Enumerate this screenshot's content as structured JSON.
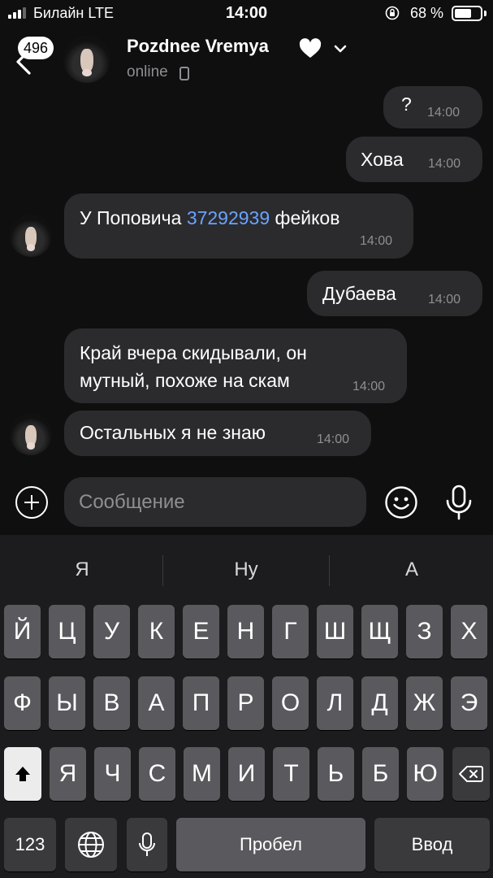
{
  "status_bar": {
    "carrier": "Билайн  LTE",
    "time": "14:00",
    "battery": "68 %",
    "battery_level": 0.68
  },
  "header": {
    "unread_count": "496",
    "contact_name": "Pozdnee Vremya",
    "status": "online"
  },
  "messages": [
    {
      "direction": "out",
      "text": "?",
      "time": "14:00"
    },
    {
      "direction": "out",
      "text": "Хова",
      "time": "14:00"
    },
    {
      "direction": "in",
      "text_before": "У Поповича ",
      "number": "37292939",
      "text_after": " фейков",
      "time": "14:00"
    },
    {
      "direction": "out",
      "text": "Дубаева",
      "time": "14:00"
    },
    {
      "direction": "in",
      "lines": [
        "Край вчера скидывали, он",
        "мутный, похоже на скам"
      ],
      "time": "14:00"
    },
    {
      "direction": "in",
      "text": "Остальных я не знаю",
      "time": "14:00"
    }
  ],
  "composer": {
    "placeholder": "Сообщение"
  },
  "keyboard": {
    "suggestions": [
      "Я",
      "Ну",
      "А"
    ],
    "row1": [
      "Й",
      "Ц",
      "У",
      "К",
      "Е",
      "Н",
      "Г",
      "Ш",
      "Щ",
      "З",
      "Х"
    ],
    "row2": [
      "Ф",
      "Ы",
      "В",
      "А",
      "П",
      "Р",
      "О",
      "Л",
      "Д",
      "Ж",
      "Э"
    ],
    "row3": [
      "Я",
      "Ч",
      "С",
      "М",
      "И",
      "Т",
      "Ь",
      "Б",
      "Ю"
    ],
    "numbers_key": "123",
    "space_key": "Пробел",
    "return_key": "Ввод"
  },
  "colors": {
    "background": "#0f0f0f",
    "bubble": "#2b2b2e",
    "link": "#6aa3ff",
    "secondary_text": "#8e8e93"
  }
}
